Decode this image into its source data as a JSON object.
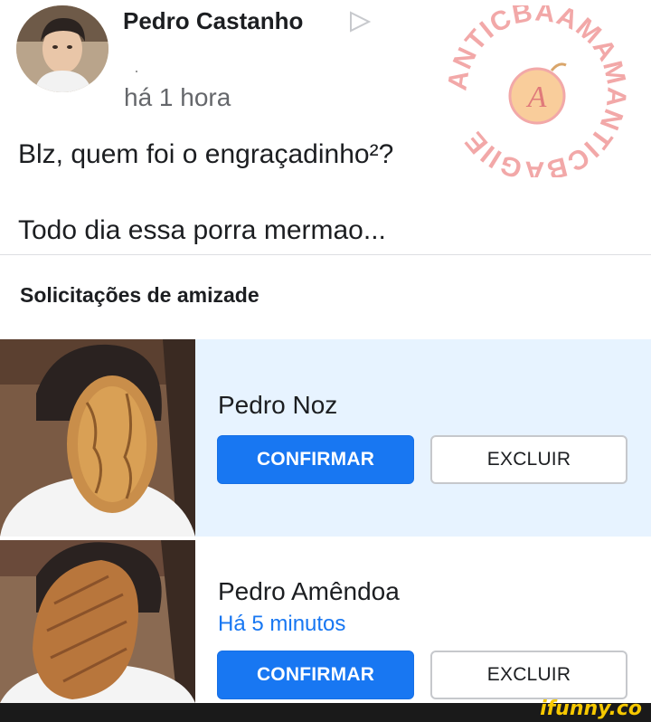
{
  "post": {
    "author_name": "Pedro Castanho",
    "time": "há 1 hora",
    "lines": [
      "Blz, quem foi o engraçadinho²?",
      "Todo dia essa porra mermao..."
    ]
  },
  "watermark": {
    "text": "ANTICBAAMAMANTICBAGIIE",
    "letter": "A",
    "color": "#f2a8a8"
  },
  "friend_requests": {
    "title": "Solicitações de amizade",
    "items": [
      {
        "name": "Pedro Noz",
        "time": "",
        "confirm_label": "CONFIRMAR",
        "delete_label": "EXCLUIR",
        "highlighted": true
      },
      {
        "name": "Pedro Amêndoa",
        "time": "Há 5 minutos",
        "confirm_label": "CONFIRMAR",
        "delete_label": "EXCLUIR",
        "highlighted": false
      }
    ]
  },
  "footer": {
    "brand": "ifunny.co",
    "brand_color": "#f6c800"
  },
  "colors": {
    "accent": "#1877f2",
    "highlight_bg": "#e7f3ff",
    "secondary_text": "#65676b"
  }
}
